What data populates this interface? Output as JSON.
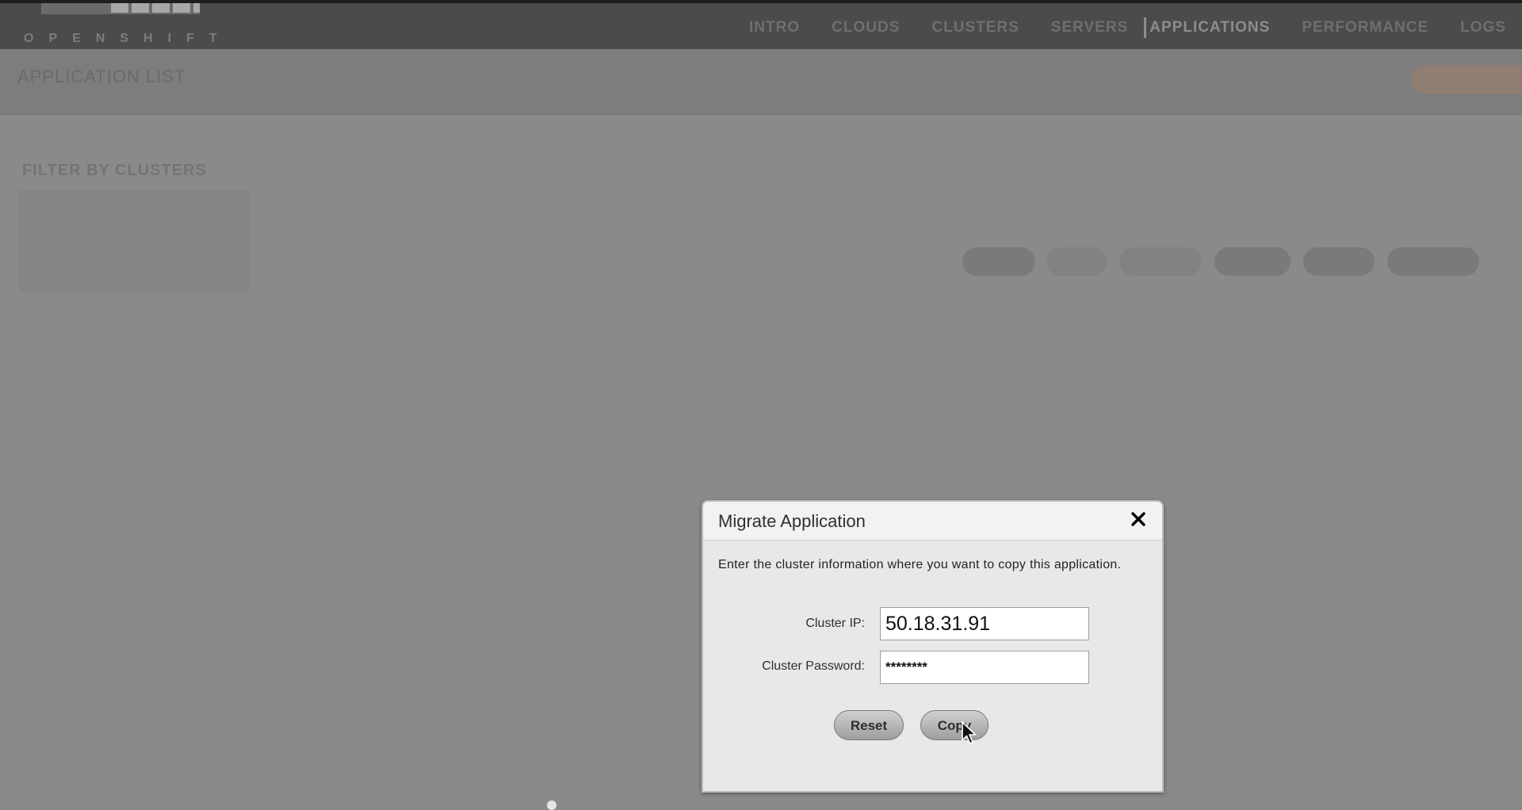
{
  "header": {
    "logo_text": "OPENSHIFT",
    "logo_subtext": "",
    "nav": [
      {
        "label": "INTRO",
        "active": false
      },
      {
        "label": "CLOUDS",
        "active": false
      },
      {
        "label": "CLUSTERS",
        "active": false
      },
      {
        "label": "SERVERS",
        "active": false
      },
      {
        "label": "APPLICATIONS",
        "active": true
      },
      {
        "label": "PERFORMANCE",
        "active": false
      },
      {
        "label": "LOGS",
        "active": false
      }
    ]
  },
  "page": {
    "title": "APPLICATION LIST",
    "add_button": ""
  },
  "filter": {
    "heading": "FILTER BY CLUSTERS",
    "items": [
      "",
      "",
      ""
    ]
  },
  "table": {
    "select_label": "",
    "headers": [
      "",
      "",
      "",
      "",
      "",
      "",
      ""
    ],
    "row": {
      "name": "",
      "cells": [
        "",
        "",
        "",
        "",
        ""
      ],
      "actions": [
        "",
        "",
        "",
        "",
        "",
        ""
      ]
    }
  },
  "modal": {
    "title": "Migrate Application",
    "intro": "Enter the cluster information where you want to copy this application.",
    "cluster_ip_label": "Cluster IP:",
    "cluster_ip_value": "50.18.31.91",
    "cluster_password_label": "Cluster Password:",
    "cluster_password_value": "********",
    "reset_label": "Reset",
    "copy_label": "Copy"
  },
  "icons": {
    "close": "close-icon",
    "cursor": "mouse-pointer-icon"
  }
}
